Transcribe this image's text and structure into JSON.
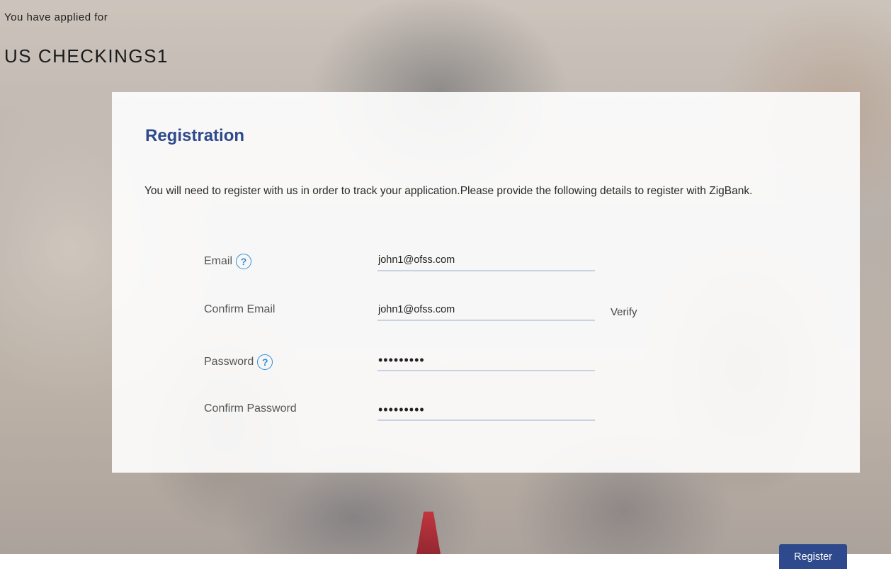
{
  "header": {
    "applied_label": "You have applied for",
    "product_name": "US CHECKINGS1"
  },
  "registration": {
    "title": "Registration",
    "description": "You will need to register with us in order to track your application.Please provide the following details to register with ZigBank.",
    "fields": {
      "email": {
        "label": "Email",
        "value": "john1@ofss.com",
        "help_icon": "question-circle-icon"
      },
      "confirm_email": {
        "label": "Confirm Email",
        "value": "john1@ofss.com"
      },
      "password": {
        "label": "Password",
        "value": "•••••••••",
        "help_icon": "question-circle-icon"
      },
      "confirm_password": {
        "label": "Confirm Password",
        "value": "•••••••••"
      }
    },
    "verify_label": "Verify",
    "help_glyph": "?"
  },
  "actions": {
    "register_label": "Register"
  },
  "colors": {
    "accent": "#2e4a8c",
    "help_icon": "#2e8fd8"
  }
}
